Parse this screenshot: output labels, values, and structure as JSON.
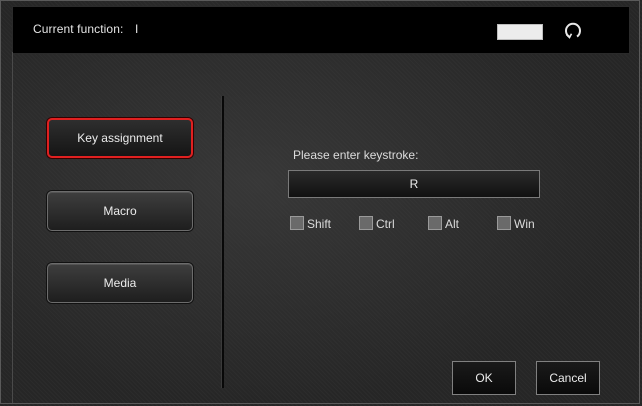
{
  "header": {
    "label": "Current function:",
    "value": "I",
    "color_swatch": "#ececec",
    "refresh_icon": "refresh-icon"
  },
  "sidebar": {
    "items": [
      {
        "label": "Key assignment",
        "selected": true
      },
      {
        "label": "Macro",
        "selected": false
      },
      {
        "label": "Media",
        "selected": false
      }
    ]
  },
  "main": {
    "prompt": "Please enter keystroke:",
    "keystroke_value": "R",
    "modifiers": [
      {
        "label": "Shift",
        "checked": false
      },
      {
        "label": "Ctrl",
        "checked": false
      },
      {
        "label": "Alt",
        "checked": false
      },
      {
        "label": "Win",
        "checked": false
      }
    ]
  },
  "buttons": {
    "ok": "OK",
    "cancel": "Cancel"
  },
  "colors": {
    "selection_border": "#e02020",
    "background": "#262626"
  }
}
